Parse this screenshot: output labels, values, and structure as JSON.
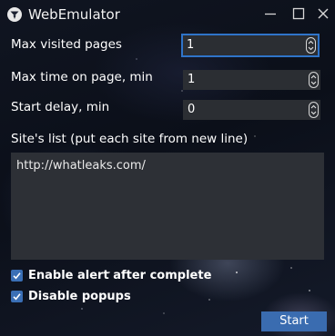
{
  "window": {
    "title": "WebEmulator",
    "logo_icon": "app-logo-icon",
    "controls": [
      "minimize-icon",
      "maximize-icon",
      "close-icon"
    ]
  },
  "settings": {
    "max_pages": {
      "label": "Max visited pages",
      "value": "1"
    },
    "max_time": {
      "label": "Max time on page, min",
      "value": "1"
    },
    "start_delay": {
      "label": "Start delay, min",
      "value": "0"
    }
  },
  "sites": {
    "label": "Site's list (put each site from new line)",
    "value": "http://whatleaks.com/"
  },
  "options": {
    "enable_alert": {
      "label": "Enable alert after complete",
      "checked": true
    },
    "disable_popups": {
      "label": "Disable popups",
      "checked": true
    }
  },
  "actions": {
    "start_label": "Start"
  },
  "colors": {
    "accent": "#3a6cb0",
    "focus_border": "#2f74c9",
    "field_bg": "#2b2e33"
  }
}
